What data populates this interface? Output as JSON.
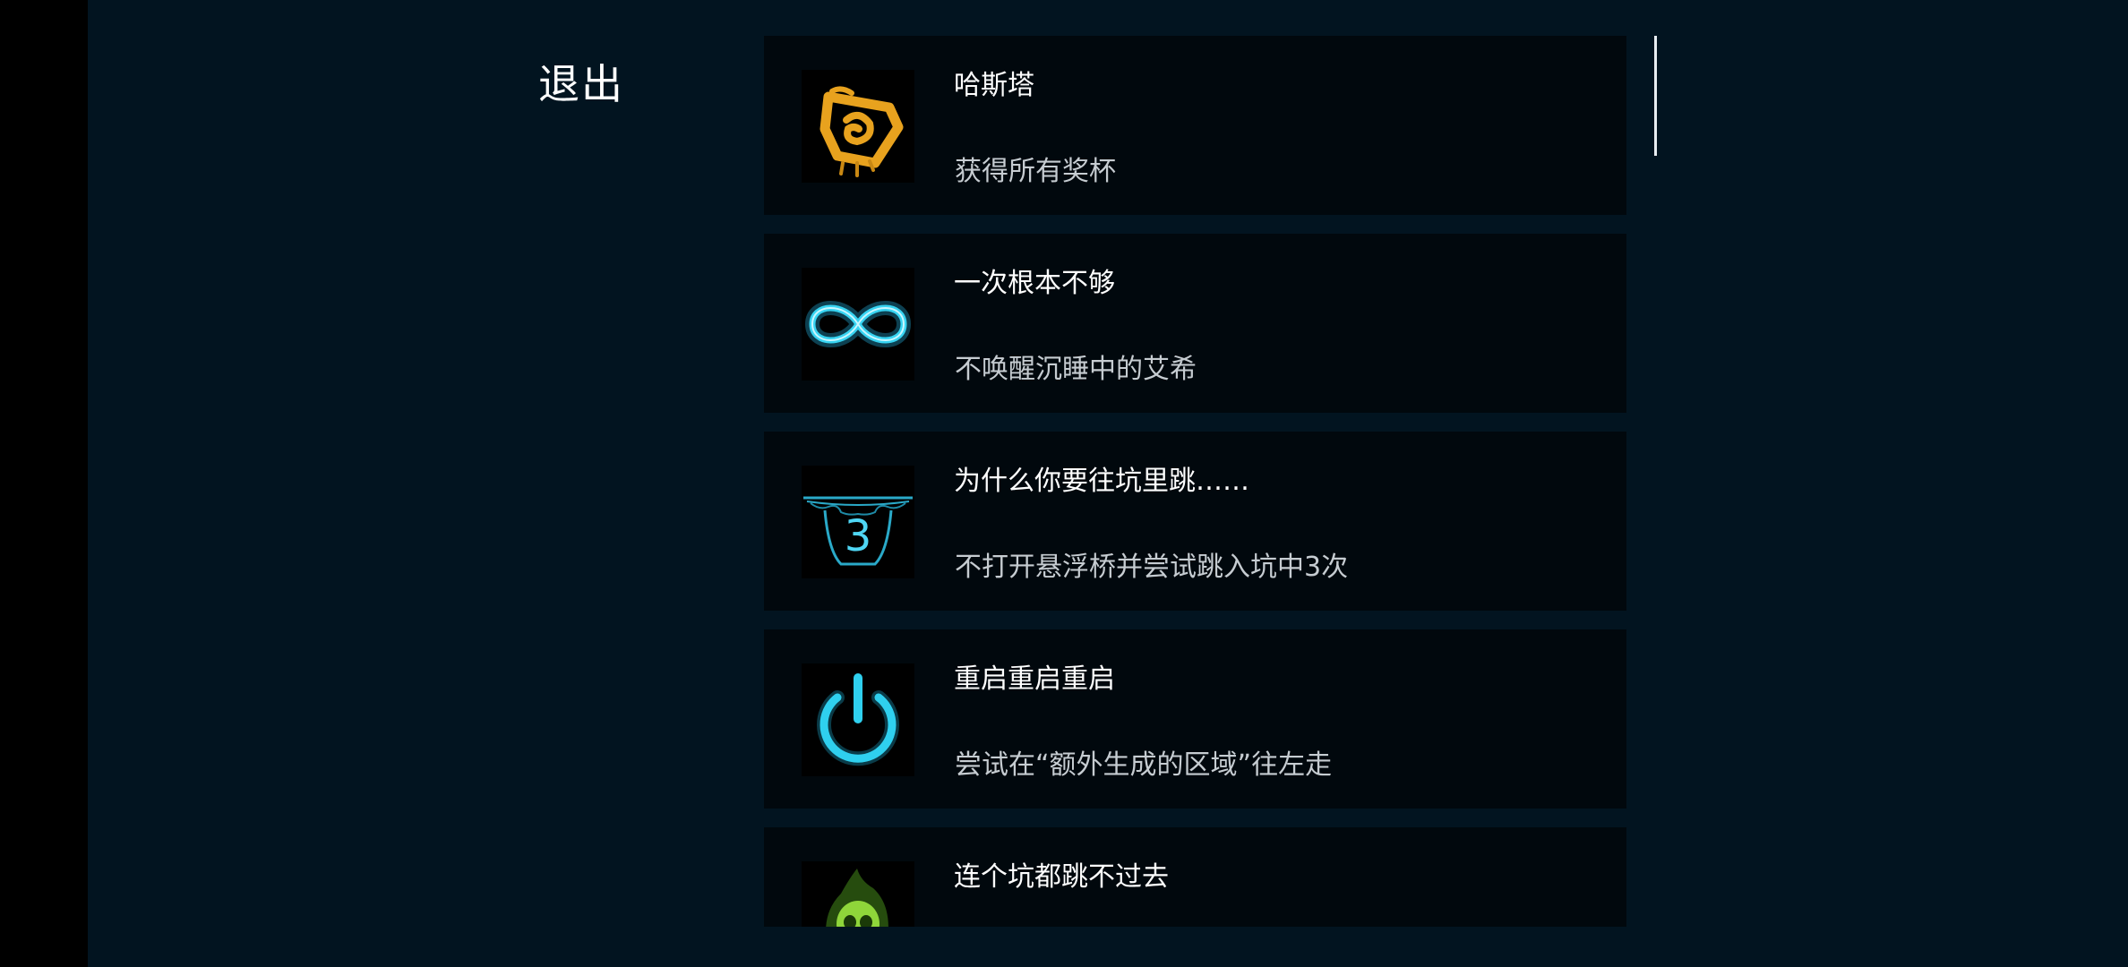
{
  "exit_label": "退出",
  "achievements": [
    {
      "title": "哈斯塔",
      "description": "获得所有奖杯",
      "icon": "hastur-sigil-icon"
    },
    {
      "title": "一次根本不够",
      "description": "不唤醒沉睡中的艾希",
      "icon": "infinity-icon"
    },
    {
      "title": "为什么你要往坑里跳……",
      "description": "不打开悬浮桥并尝试跳入坑中3次",
      "icon": "pit-bridge-icon",
      "badge": "3"
    },
    {
      "title": "重启重启重启",
      "description": "尝试在“额外生成的区域”往左走",
      "icon": "power-icon"
    },
    {
      "title": "连个坑都跳不过去",
      "description": "",
      "icon": "green-skull-icon"
    }
  ],
  "colors": {
    "background": "#021420",
    "card": "#01080d",
    "gold": "#e8a21e",
    "cyan": "#29c6e8",
    "green": "#7bd230"
  }
}
